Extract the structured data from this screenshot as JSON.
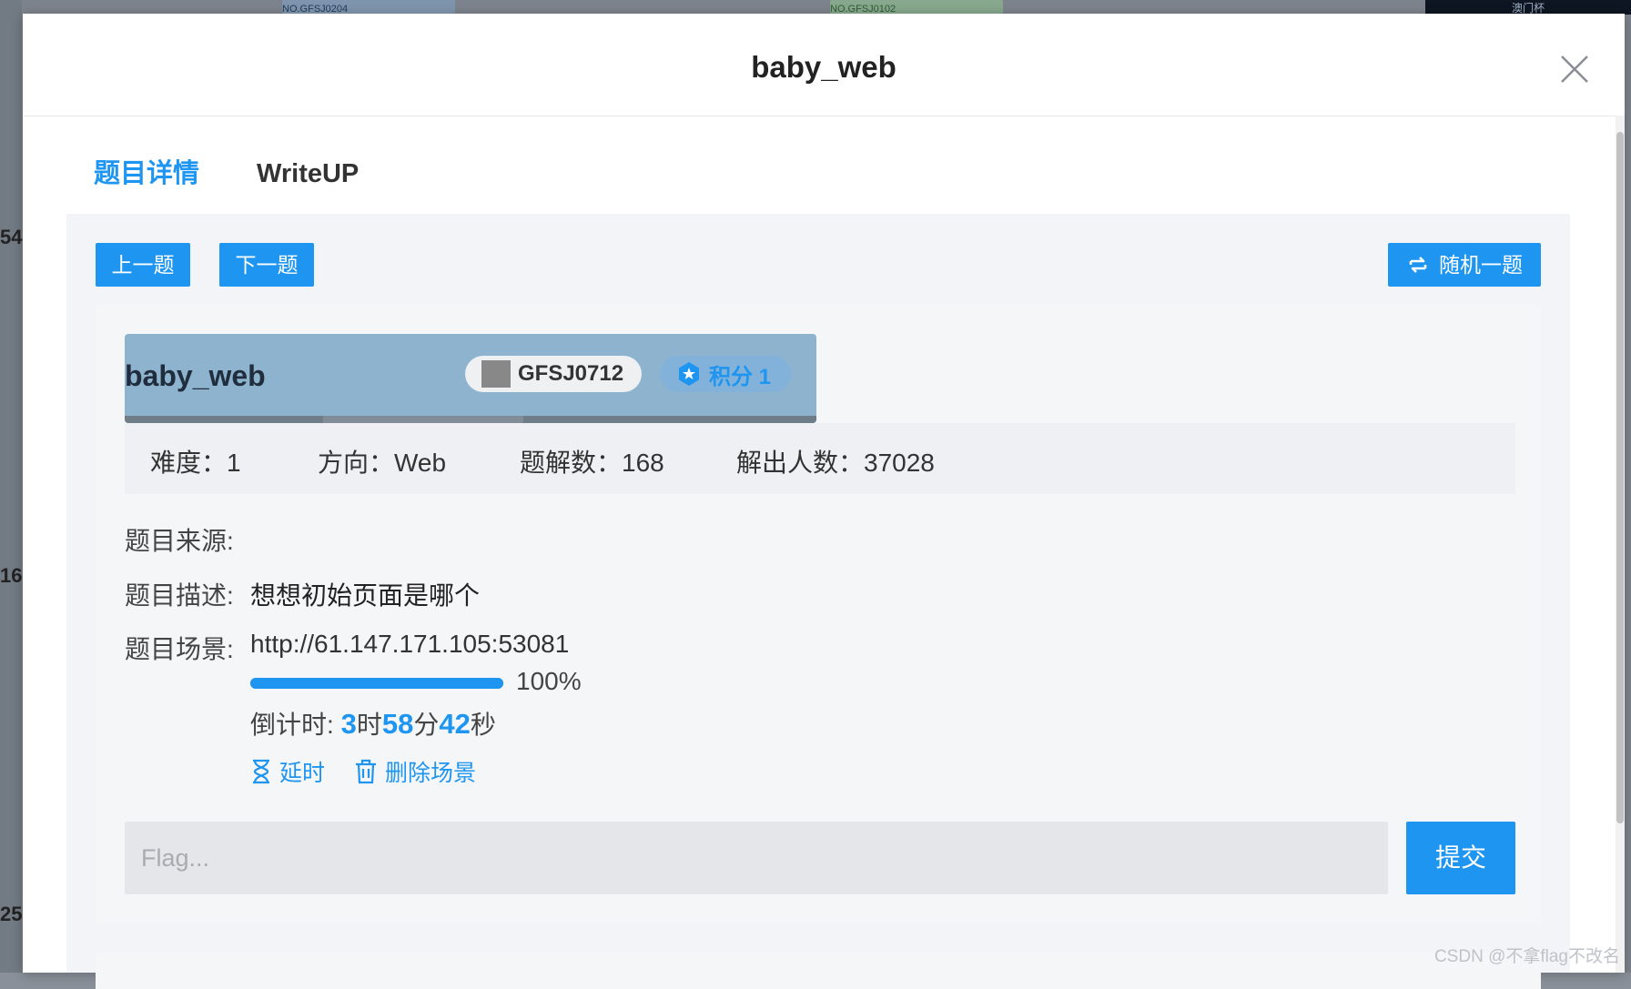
{
  "background": {
    "side_numbers": [
      "54",
      "16",
      "25"
    ],
    "top_labels": [
      "NO.GFSJ0204",
      "NO.GFSJ0102"
    ],
    "thumb_label": "澳门杯"
  },
  "modal": {
    "title": "baby_web",
    "close_icon": "close-icon"
  },
  "tabs": [
    {
      "label": "题目详情",
      "active": true
    },
    {
      "label": "WriteUP",
      "active": false
    }
  ],
  "nav": {
    "prev_label": "上一题",
    "next_label": "下一题",
    "random_label": "随机一题"
  },
  "challenge": {
    "name": "baby_web",
    "id": "GFSJ0712",
    "score_label": "积分 1",
    "difficulty": "难度：1",
    "direction": "方向：Web",
    "writeups": "题解数：168",
    "solvers": "解出人数：37028",
    "source_label": "题目来源:",
    "desc_label": "题目描述:",
    "desc_value": "想想初始页面是哪个",
    "scene_label": "题目场景:",
    "scene_url": "http://61.147.171.105:53081",
    "progress": 1.0,
    "progress_label": "100%",
    "countdown_prefix": "倒计时: ",
    "hours": "3",
    "hours_unit": "时",
    "minutes": "58",
    "minutes_unit": "分",
    "seconds": "42",
    "seconds_unit": "秒",
    "extend_label": "延时",
    "delete_label": "删除场景"
  },
  "flag": {
    "placeholder": "Flag...",
    "submit_label": "提交"
  },
  "watermark": "CSDN @不拿flag不改名",
  "colors": {
    "accent": "#1e95f0",
    "title_bar": "#8db3cf"
  }
}
